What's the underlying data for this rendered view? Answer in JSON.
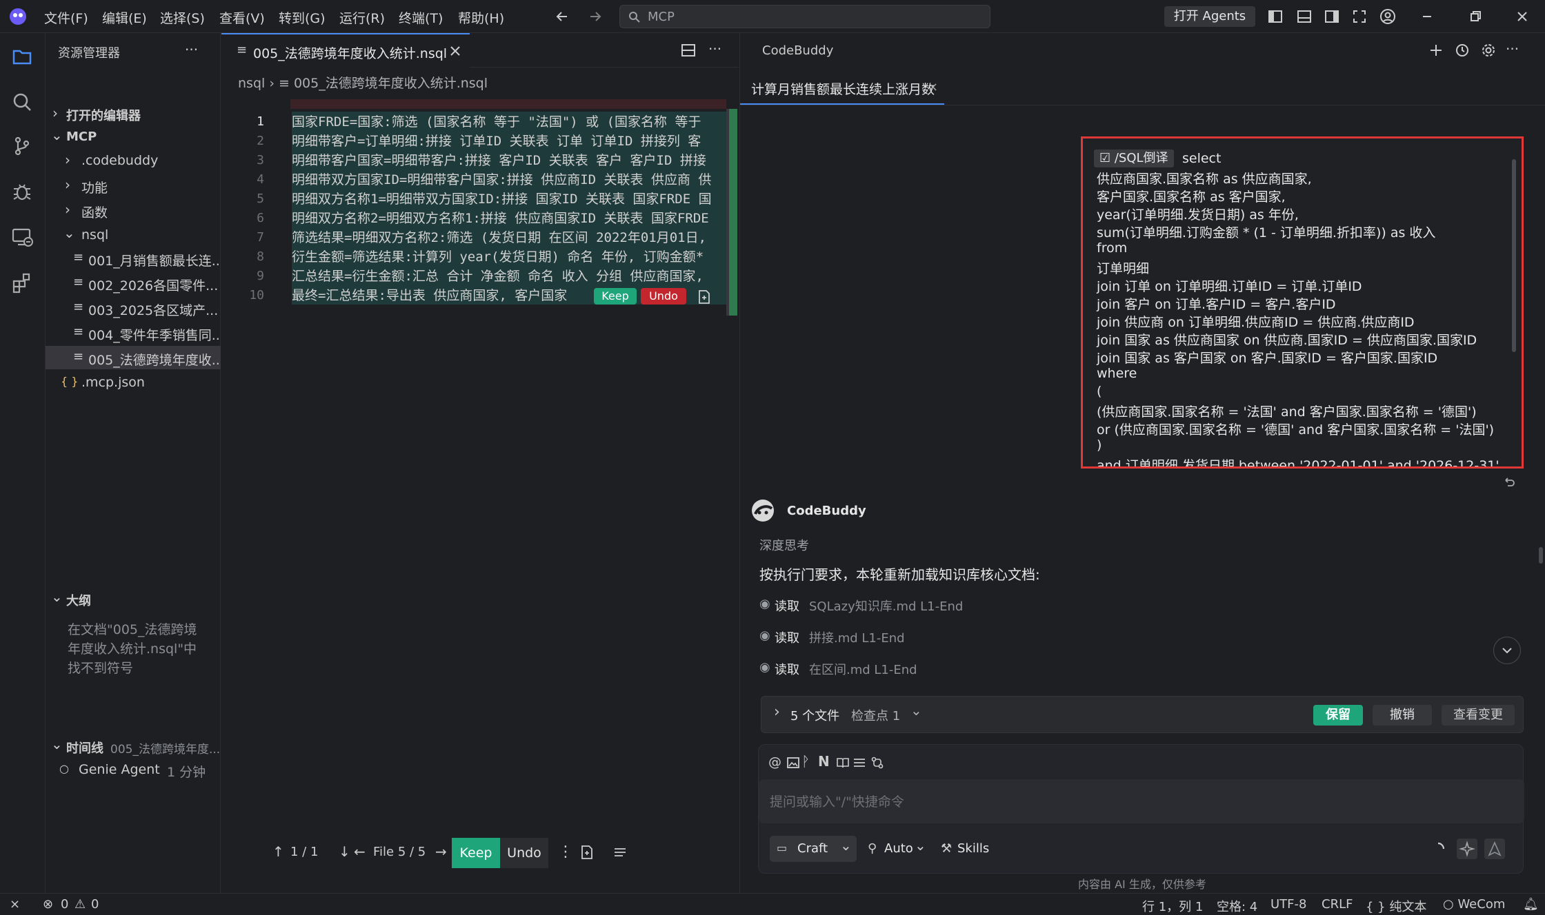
{
  "menu": [
    "文件(F)",
    "编辑(E)",
    "选择(S)",
    "查看(V)",
    "转到(G)",
    "运行(R)",
    "终端(T)",
    "帮助(H)"
  ],
  "search": {
    "text": "MCP"
  },
  "title_actions": {
    "agents": "打开 Agents"
  },
  "explorer": {
    "title": "资源管理器",
    "more": "···",
    "open_editors": "打开的编辑器",
    "root": "MCP",
    "folders": [
      ".codebuddy",
      "功能",
      "函数",
      "nsql"
    ],
    "files": [
      "001_月销售额最长连...",
      "002_2026各国零件...",
      "003_2025各区域产...",
      "004_零件年季销售同...",
      "005_法德跨境年度收..."
    ],
    "root_file": ".mcp.json",
    "json_glyph": "{ }",
    "outline_title": "大纲",
    "outline_msg": [
      "在文档\"005_法德跨境",
      "年度收入统计.nsql\"中",
      "找不到符号"
    ],
    "timeline_title": "时间线",
    "timeline_file": "005_法德跨境年度...",
    "timeline_entry": "Genie Agent",
    "timeline_time": "1 分钟"
  },
  "editor": {
    "tab": "005_法德跨境年度收入统计.nsql",
    "breadcrumb_dir": "nsql",
    "breadcrumb_file": "005_法德跨境年度收入统计.nsql",
    "more": "···",
    "line_numbers": [
      "1",
      "2",
      "3",
      "4",
      "5",
      "6",
      "7",
      "8",
      "9",
      "10"
    ],
    "lines": [
      "国家FRDE=国家:筛选 (国家名称 等于 \"法国\") 或 (国家名称 等于",
      "明细带客户=订单明细:拼接 订单ID 关联表 订单 订单ID 拼接列 客",
      "明细带客户国家=明细带客户:拼接 客户ID 关联表 客户 客户ID 拼接",
      "明细带双方国家ID=明细带客户国家:拼接 供应商ID 关联表 供应商 供",
      "明细双方名称1=明细带双方国家ID:拼接 国家ID 关联表 国家FRDE 国",
      "明细双方名称2=明细双方名称1:拼接 供应商国家ID 关联表 国家FRDE",
      "筛选结果=明细双方名称2:筛选 (发货日期 在区间 2022年01月01日,",
      "衍生金额=筛选结果:计算列 year(发货日期) 命名 年份, 订购金额*",
      "汇总结果=衍生金额:汇总 合计 净金额 命名 收入 分组 供应商国家,",
      "最终=汇总结果:导出表 供应商国家, 客户国家"
    ],
    "inline_keep": "Keep",
    "inline_undo": "Undo",
    "nav": {
      "count": "1 / 1",
      "file": "File 5 / 5",
      "keep": "Keep",
      "undo": "Undo",
      "more": "⋮"
    }
  },
  "chat": {
    "header": "CodeBuddy",
    "tab": "计算月销售额最长连续上涨月数",
    "sql_tag": "/SQL倒译",
    "sql_lines": [
      "select",
      " 供应商国家.国家名称 as 供应商国家,",
      " 客户国家.国家名称 as 客户国家,",
      " year(订单明细.发货日期) as 年份,",
      " sum(订单明细.订购金额 * (1 - 订单明细.折扣率)) as 收入",
      "from",
      " 订单明细",
      " join 订单 on 订单明细.订单ID = 订单.订单ID",
      " join 客户 on 订单.客户ID = 客户.客户ID",
      " join 供应商 on 订单明细.供应商ID = 供应商.供应商ID",
      " join 国家 as 供应商国家 on 供应商.国家ID = 供应商国家.国家ID",
      " join 国家 as 客户国家 on 客户.国家ID = 客户国家.国家ID",
      "where",
      " (",
      " (供应商国家.国家名称 = '法国' and 客户国家.国家名称 = '德国')",
      " or (供应商国家.国家名称 = '德国' and 客户国家.国家名称 = '法国')",
      " )",
      " and 订单明细.发货日期 between '2022-01-01' and '2026-12-31'"
    ],
    "bot_name": "CodeBuddy",
    "thinking": "深度思考",
    "message": "按执行门要求，本轮重新加载知识库核心文档:",
    "reads": [
      {
        "verb": "读取",
        "file": "SQLazy知识库.md L1-End"
      },
      {
        "verb": "读取",
        "file": "拼接.md L1-End"
      },
      {
        "verb": "读取",
        "file": "在区间.md L1-End"
      }
    ],
    "files_bar": {
      "files": "5 个文件",
      "checkpoint": "检查点 1",
      "keep": "保留",
      "undo": "撤销",
      "view": "查看变更"
    },
    "input_placeholder": "提问或输入\"/\"快捷命令",
    "mode": "Craft",
    "model": "Auto",
    "skills": "Skills",
    "disclaimer": "内容由 AI 生成，仅供参考"
  },
  "status": {
    "errors": "0",
    "warnings": "0",
    "position": "行 1，列 1",
    "spaces": "空格: 4",
    "encoding": "UTF-8",
    "eol": "CRLF",
    "language": "{ } 纯文本",
    "wecom": "WeCom"
  },
  "colors": {
    "accent": "#4a8df7",
    "keep": "#1fa57a",
    "undo": "#c4262e",
    "highlight_border": "#e03737"
  }
}
